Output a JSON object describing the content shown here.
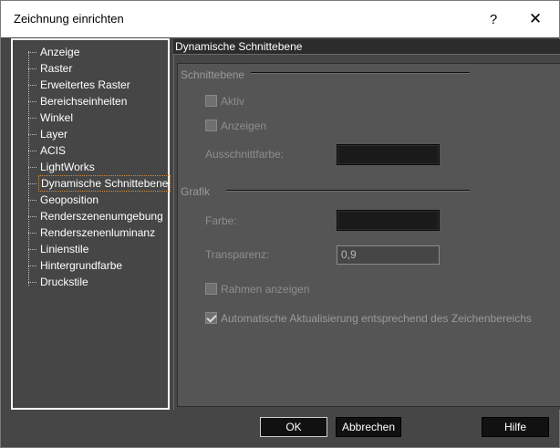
{
  "window": {
    "title": "Zeichnung einrichten",
    "help_glyph": "?",
    "close_glyph": "✕"
  },
  "tree": {
    "items": [
      {
        "label": "Anzeige"
      },
      {
        "label": "Raster"
      },
      {
        "label": "Erweitertes Raster"
      },
      {
        "label": "Bereichseinheiten"
      },
      {
        "label": "Winkel"
      },
      {
        "label": "Layer"
      },
      {
        "label": "ACIS"
      },
      {
        "label": "LightWorks"
      },
      {
        "label": "Dynamische Schnittebene"
      },
      {
        "label": "Geoposition"
      },
      {
        "label": "Renderszenenumgebung"
      },
      {
        "label": "Renderszenenluminanz"
      },
      {
        "label": "Linienstile"
      },
      {
        "label": "Hintergrundfarbe"
      },
      {
        "label": "Druckstile"
      }
    ],
    "selected": "Dynamische Schnittebene"
  },
  "panel": {
    "header": "Dynamische Schnittebene",
    "schnittebene": {
      "group_label": "Schnittebene",
      "aktiv_label": "Aktiv",
      "aktiv_checked": false,
      "anzeigen_label": "Anzeigen",
      "anzeigen_checked": false,
      "ausschnittfarbe_label": "Ausschnittfarbe:",
      "ausschnittfarbe_color": "#1a1a1a"
    },
    "grafik": {
      "group_label": "Grafik",
      "farbe_label": "Farbe:",
      "farbe_color": "#1a1a1a",
      "transparenz_label": "Transparenz:",
      "transparenz_value": "0,9",
      "rahmen_label": "Rahmen anzeigen",
      "rahmen_checked": false,
      "auto_update_label": "Automatische Aktualisierung entsprechend des Zeichenbereichs",
      "auto_update_checked": true
    }
  },
  "buttons": {
    "ok": "OK",
    "cancel": "Abbrechen",
    "help": "Hilfe"
  },
  "colors": {
    "dialog_bg": "#464646",
    "panel_bg": "#555555",
    "selection_outline": "#d08c3c"
  }
}
